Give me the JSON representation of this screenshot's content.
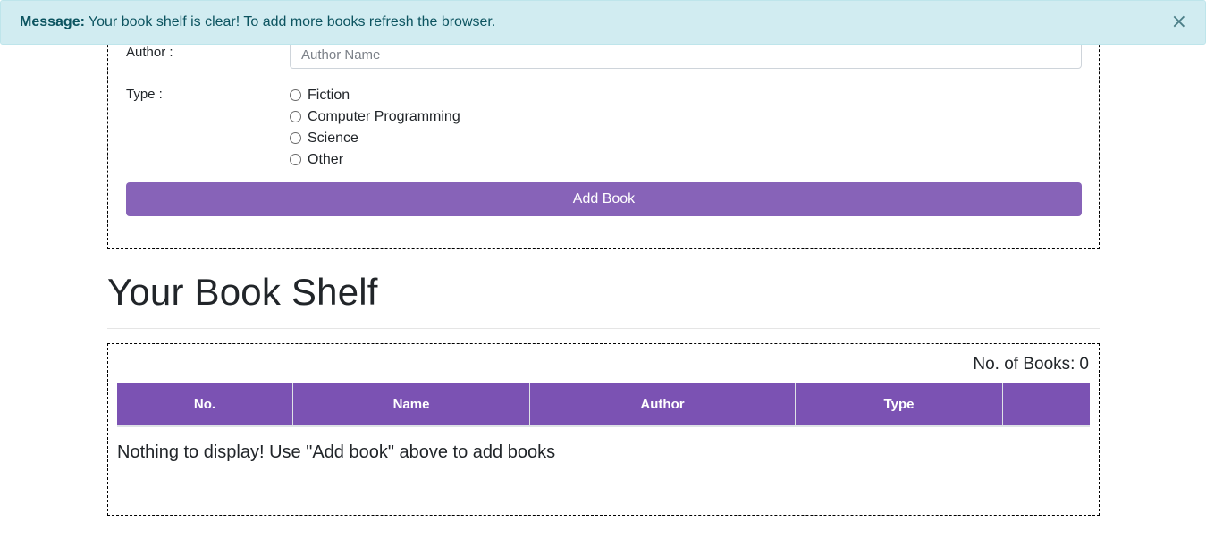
{
  "alert": {
    "label": "Message:",
    "text": "Your book shelf is clear! To add more books refresh the browser.",
    "close": "×"
  },
  "form": {
    "author_label": "Author :",
    "author_placeholder": "Author Name",
    "type_label": "Type :",
    "types": [
      "Fiction",
      "Computer Programming",
      "Science",
      "Other"
    ],
    "submit_label": "Add Book"
  },
  "shelf": {
    "title": "Your Book Shelf",
    "count_label": "No. of Books:",
    "count_value": "0",
    "columns": [
      "No.",
      "Name",
      "Author",
      "Type",
      ""
    ],
    "empty_message": "Nothing to display! Use \"Add book\" above to add books"
  },
  "colors": {
    "accent": "#8763b8",
    "table_header": "#7b52b3",
    "alert_bg": "#d1ecf1",
    "alert_text": "#0c5460"
  }
}
